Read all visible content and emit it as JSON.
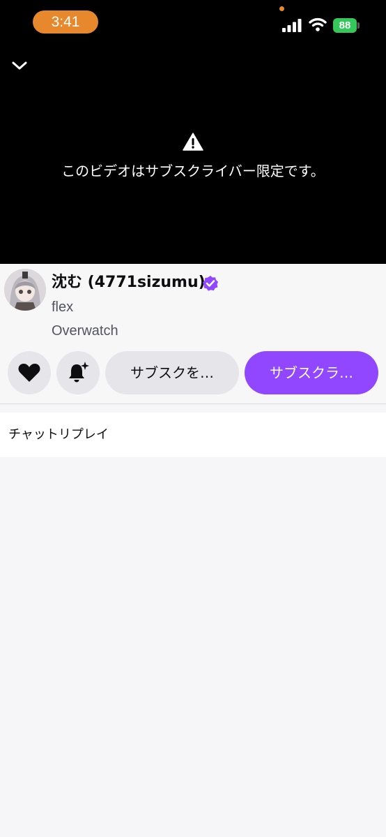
{
  "status_bar": {
    "time": "3:41",
    "battery": "88"
  },
  "player": {
    "notice": "このビデオはサブスクライバー限定です。"
  },
  "channel": {
    "name": "沈む (4771sizumu)",
    "title": "flex",
    "game": "Overwatch"
  },
  "actions": {
    "gift_label": "サブスクを…",
    "subscribe_label": "サブスクラ…"
  },
  "chat": {
    "label": "チャットリプレイ"
  },
  "colors": {
    "accent": "#9147ff",
    "time_pill": "#e8882c",
    "battery": "#34c759"
  }
}
